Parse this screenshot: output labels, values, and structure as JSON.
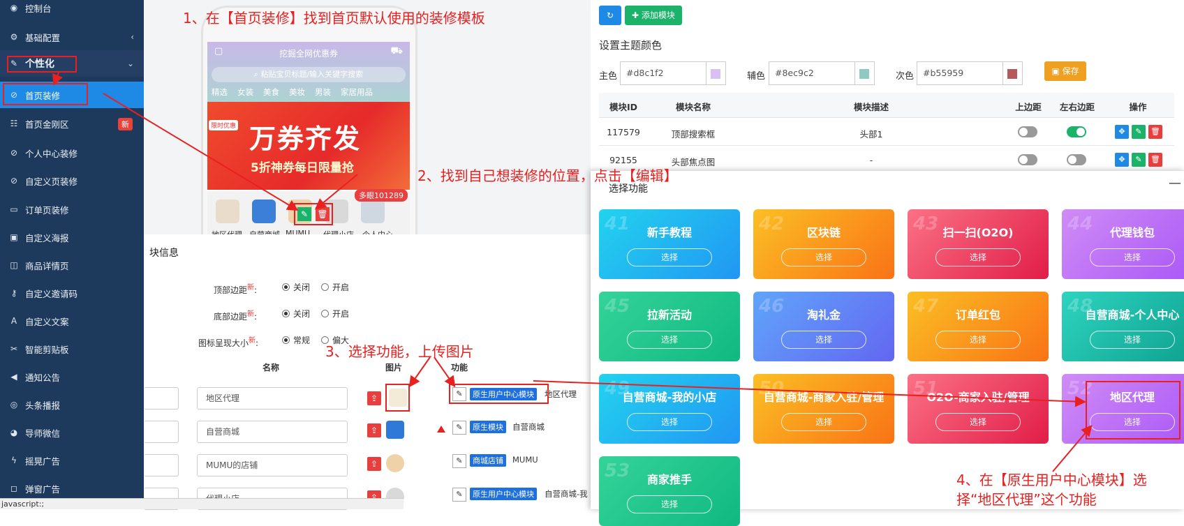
{
  "sidebar": {
    "items": [
      {
        "icon": "dashboard-icon",
        "glyph": "◉",
        "label": "控制台"
      },
      {
        "icon": "gears-icon",
        "glyph": "⚙",
        "label": "基础配置"
      },
      {
        "icon": "paint-icon",
        "glyph": "✎",
        "label": "个性化"
      },
      {
        "icon": "compass-icon",
        "glyph": "⊘",
        "label": "首页装修"
      },
      {
        "icon": "grid-icon",
        "glyph": "☷",
        "label": "首页金刚区",
        "badge": "新"
      },
      {
        "icon": "compass-icon",
        "glyph": "⊘",
        "label": "个人中心装修"
      },
      {
        "icon": "compass-icon",
        "glyph": "⊘",
        "label": "自定义页装修"
      },
      {
        "icon": "window-icon",
        "glyph": "▭",
        "label": "订单页装修"
      },
      {
        "icon": "image-icon",
        "glyph": "▣",
        "label": "自定义海报"
      },
      {
        "icon": "columns-icon",
        "glyph": "◫",
        "label": "商品详情页"
      },
      {
        "icon": "key-icon",
        "glyph": "⚷",
        "label": "自定义邀请码"
      },
      {
        "icon": "font-icon",
        "glyph": "A",
        "label": "自定义文案"
      },
      {
        "icon": "scissors-icon",
        "glyph": "✂",
        "label": "智能剪贴板"
      },
      {
        "icon": "bullhorn-icon",
        "glyph": "◀",
        "label": "通知公告"
      },
      {
        "icon": "podcast-icon",
        "glyph": "◎",
        "label": "头条播报"
      },
      {
        "icon": "wechat-icon",
        "glyph": "◕",
        "label": "导师微信"
      },
      {
        "icon": "bolt-icon",
        "glyph": "ϟ",
        "label": "摇晃广告"
      },
      {
        "icon": "popup-icon",
        "glyph": "◻",
        "label": "弹窗广告"
      }
    ]
  },
  "phone": {
    "title": "挖掘全网优惠券",
    "search_placeholder": "粘贴宝贝标题/输入关键字搜索",
    "categories": [
      "精选",
      "女装",
      "美食",
      "美妆",
      "男装",
      "家居用品"
    ],
    "banner_tag": "限时优惠",
    "banner_title": "万券齐发",
    "banner_sub": "5折神券每日限量抢",
    "badge": "多眼101289",
    "icon_labels": [
      "地区代理",
      "自营商城",
      "MUMU...",
      "代理小店",
      "个人中心"
    ]
  },
  "info": {
    "title": "块信息",
    "top_margin_label": "顶部边距",
    "bottom_margin_label": "底部边距",
    "icon_size_label": "图标呈现大小",
    "new_mark": "新",
    "colon": ":",
    "opt_off": "关闭",
    "opt_on": "开启",
    "opt_normal": "常规",
    "opt_large": "偏大",
    "col_name": "名称",
    "col_pic": "图片",
    "col_fn": "功能",
    "rows": [
      {
        "name": "地区代理",
        "tag": "原生用户中心模块",
        "fn": "地区代理"
      },
      {
        "name": "自营商城",
        "tag": "原生模块",
        "fn": "自营商城"
      },
      {
        "name": "MUMU的店铺",
        "tag": "商城店铺",
        "fn": "MUMU"
      },
      {
        "name": "代理小店",
        "tag": "原生用户中心模块",
        "fn": "自营商城-我"
      }
    ]
  },
  "toolbar": {
    "refresh_label": "",
    "add_label": "添加模块"
  },
  "theme": {
    "title": "设置主题颜色",
    "primary_label": "主色",
    "primary_value": "#d8c1f2",
    "secondary_label": "辅色",
    "secondary_value": "#8ec9c2",
    "tertiary_label": "次色",
    "tertiary_value": "#b55959",
    "save_label": "保存",
    "colors": {
      "primary": "#d8c1f2",
      "secondary": "#8ec9c2",
      "tertiary": "#b55959"
    }
  },
  "table": {
    "headers": [
      "模块ID",
      "模块名称",
      "模块描述",
      "上边距",
      "左右边距",
      "操作"
    ],
    "rows": [
      {
        "id": "117579",
        "name": "顶部搜索框",
        "desc": "头部1",
        "top": false,
        "side": true
      },
      {
        "id": "92155",
        "name": "头部焦点图",
        "desc": "-",
        "top": false,
        "side": false
      }
    ]
  },
  "functions": {
    "title": "选择功能",
    "minimize": "—",
    "pick_label": "选择",
    "cards": [
      {
        "num": "41",
        "name": "新手教程",
        "color": "cyan"
      },
      {
        "num": "42",
        "name": "区块链",
        "color": "orange"
      },
      {
        "num": "43",
        "name": "扫一扫(O2O)",
        "color": "red"
      },
      {
        "num": "44",
        "name": "代理钱包",
        "color": "purple"
      },
      {
        "num": "45",
        "name": "拉新活动",
        "color": "green"
      },
      {
        "num": "46",
        "name": "淘礼金",
        "color": "blue"
      },
      {
        "num": "47",
        "name": "订单红包",
        "color": "orange"
      },
      {
        "num": "48",
        "name": "自营商城-个人中心",
        "color": "teal"
      },
      {
        "num": "49",
        "name": "自营商城-我的小店",
        "color": "cyan"
      },
      {
        "num": "50",
        "name": "自营商城-商家入驻/管理",
        "color": "orange"
      },
      {
        "num": "51",
        "name": "O2O-商家入驻/管理",
        "color": "red"
      },
      {
        "num": "52",
        "name": "地区代理",
        "color": "purple"
      },
      {
        "num": "53",
        "name": "商家推手",
        "color": "green"
      }
    ]
  },
  "annotations": {
    "step1": "1、在【首页装修】找到首页默认使用的装修模板",
    "step2": "2、找到自己想装修的位置，点击【编辑】",
    "step3": "3、选择功能，上传图片",
    "step4_line1": "4、在【原生用户中心模块】选",
    "step4_line2": "择“地区代理”这个功能"
  },
  "status_bar": "javascript:;"
}
